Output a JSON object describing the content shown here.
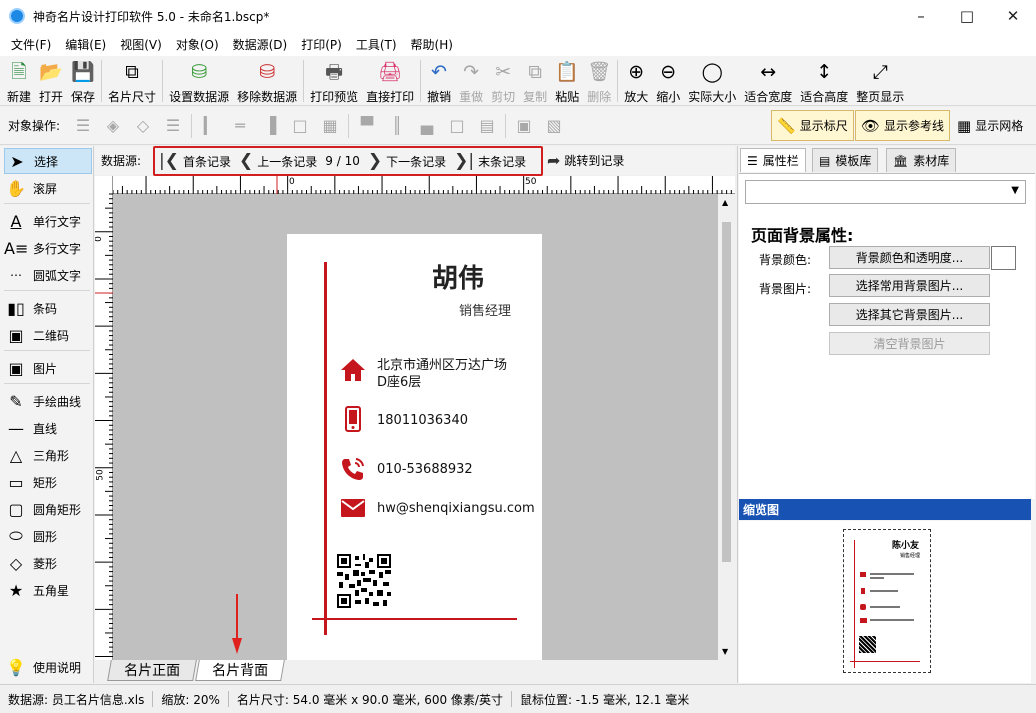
{
  "window": {
    "title": "神奇名片设计打印软件 5.0 - 未命名1.bscp*"
  },
  "menu": [
    "文件(F)",
    "编辑(E)",
    "视图(V)",
    "对象(O)",
    "数据源(D)",
    "打印(P)",
    "工具(T)",
    "帮助(H)"
  ],
  "toolbar": {
    "new": "新建",
    "open": "打开",
    "save": "保存",
    "card_size": "名片尺寸",
    "set_datasource": "设置数据源",
    "remove_datasource": "移除数据源",
    "print_preview": "打印预览",
    "direct_print": "直接打印",
    "undo": "撤销",
    "redo": "重做",
    "cut": "剪切",
    "copy": "复制",
    "paste": "粘贴",
    "delete": "删除",
    "zoom_in": "放大",
    "zoom_out": "缩小",
    "actual_size": "实际大小",
    "fit_width": "适合宽度",
    "fit_height": "适合高度",
    "fit_page": "整页显示"
  },
  "objbar": {
    "label": "对象操作:",
    "show_ruler": "显示标尺",
    "show_guides": "显示参考线",
    "show_grid": "显示网格"
  },
  "tools": {
    "select": "选择",
    "scroll": "滚屏",
    "single_text": "单行文字",
    "multi_text": "多行文字",
    "arc_text": "圆弧文字",
    "barcode": "条码",
    "qrcode": "二维码",
    "image": "图片",
    "freehand": "手绘曲线",
    "line": "直线",
    "triangle": "三角形",
    "rect": "矩形",
    "round_rect": "圆角矩形",
    "ellipse": "圆形",
    "diamond": "菱形",
    "star": "五角星",
    "help": "使用说明"
  },
  "datasource": {
    "label": "数据源:",
    "first": "首条记录",
    "prev": "上一条记录",
    "counter": "9 / 10",
    "next": "下一条记录",
    "last": "末条记录",
    "jump": "跳转到记录"
  },
  "ruler": {
    "h0": "0",
    "h50": "50",
    "v0": "0",
    "v50": "50"
  },
  "card": {
    "name": "胡伟",
    "job_title": "销售经理",
    "address_line1": "北京市通州区万达广场",
    "address_line2": "D座6层",
    "mobile": "18011036340",
    "phone": "010-53688932",
    "email": "hw@shenqixiangsu.com",
    "accent_color": "#c4161c"
  },
  "page_tabs": {
    "front": "名片正面",
    "back": "名片背面"
  },
  "right_panel": {
    "tabs": {
      "properties": "属性栏",
      "templates": "模板库",
      "materials": "素材库"
    },
    "section_title": "页面背景属性:",
    "bg_color_label": "背景颜色:",
    "bg_color_btn": "背景颜色和透明度...",
    "bg_image_label": "背景图片:",
    "bg_common_btn": "选择常用背景图片...",
    "bg_other_btn": "选择其它背景图片...",
    "bg_clear_btn": "清空背景图片",
    "preview_title": "缩览图",
    "thumb_name": "陈小友",
    "thumb_title": "销售经理"
  },
  "status": {
    "datasource": "数据源: 员工名片信息.xls",
    "zoom": "缩放: 20%",
    "card_size": "名片尺寸: 54.0 毫米 x 90.0 毫米, 600 像素/英寸",
    "mouse": "鼠标位置: -1.5 毫米, 12.1 毫米"
  }
}
